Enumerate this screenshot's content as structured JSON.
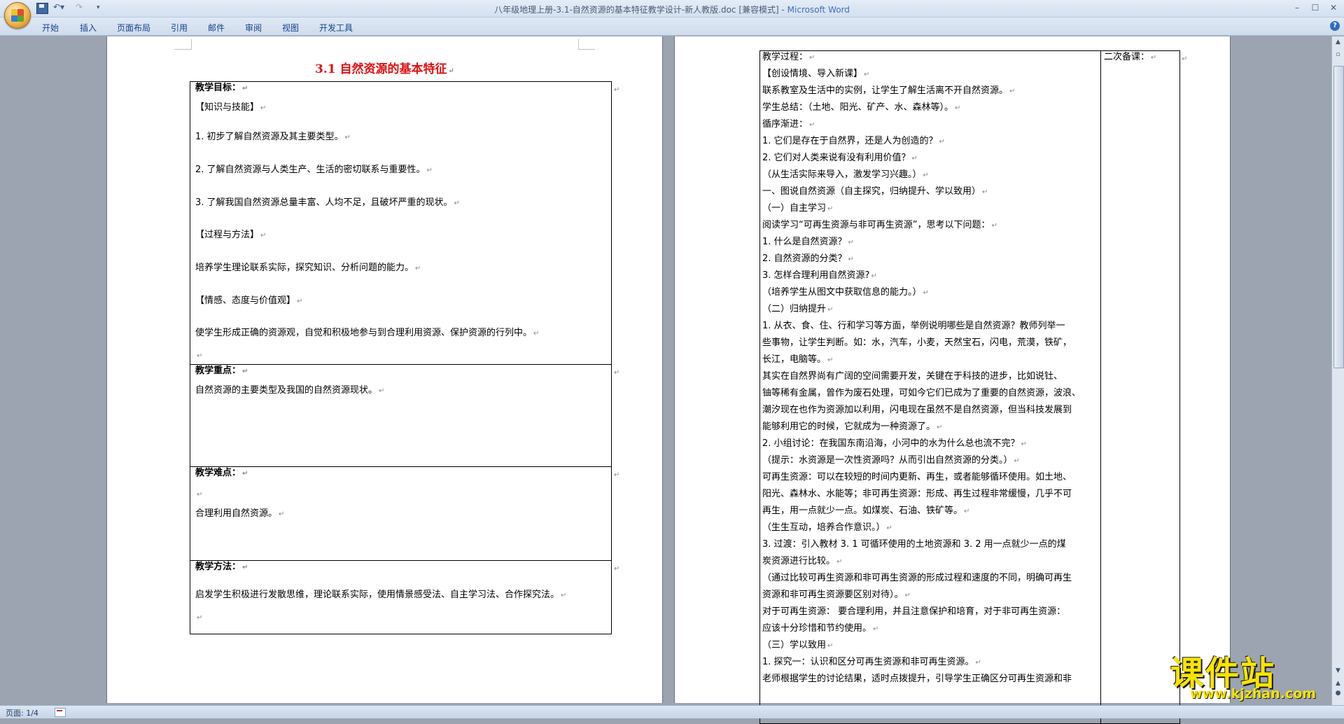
{
  "window": {
    "title": "八年级地理上册-3.1-自然资源的基本特征教学设计-新人教版.doc [兼容模式] - ",
    "app_name": "Microsoft Word"
  },
  "ribbon": {
    "tabs": [
      "开始",
      "插入",
      "页面布局",
      "引用",
      "邮件",
      "审阅",
      "视图",
      "开发工具"
    ]
  },
  "status": {
    "page": "页面: 1/4"
  },
  "watermark": {
    "main": "课件站",
    "url": "www.kjzhan.com"
  },
  "page1": {
    "title": "3.1  自然资源的基本特征",
    "goal_header": "教学目标：",
    "goal_lines": [
      "【知识与技能】",
      "1. 初步了解自然资源及其主要类型。",
      "2. 了解自然资源与人类生产、生活的密切联系与重要性。",
      "3. 了解我国自然资源总量丰富、人均不足，且破坏严重的现状。",
      "【过程与方法】",
      "培养学生理论联系实际，探究知识、分析问题的能力。",
      "【情感、态度与价值观】",
      "使学生形成正确的资源观，自觉和积极地参与到合理利用资源、保护资源的行列中。"
    ],
    "key_header": "教学重点：",
    "key_text": "自然资源的主要类型及我国的自然资源现状。",
    "diff_header": "教学难点：",
    "diff_text": "合理利用自然资源。",
    "method_header": "教学方法：",
    "method_text": "启发学生积极进行发散思维，理论联系实际，使用情景感受法、自主学习法、合作探究法。"
  },
  "page2": {
    "side_header": "二次备课：",
    "lines": [
      "教学过程：",
      "【创设情境、导入新课】",
      "    联系教室及生活中的实例，让学生了解生活离不开自然资源。",
      "学生总结：（土地、阳光、矿产、水、森林等）。",
      "循序渐进：",
      "1. 它们是存在于自然界，还是人为创造的？",
      "2. 它们对人类来说有没有利用价值？",
      "（从生活实际来导入，激发学习兴趣。）",
      "一、图说自然资源（自主探究，归纳提升、学以致用）",
      "（一）自主学习",
      "阅读学习“可再生资源与非可再生资源”，思考以下问题：",
      "1. 什么是自然资源？",
      "2. 自然资源的分类？",
      "3. 怎样合理利用自然资源?",
      "（培养学生从图文中获取信息的能力。）",
      "（二）归纳提升",
      "1. 从衣、食、住、行和学习等方面，举例说明哪些是自然资源？教师列举一",
      "些事物，让学生判断。如：水，汽车，小麦，天然宝石，闪电，荒漠，铁矿，",
      "长江，电脑等。",
      "    其实在自然界尚有广阔的空间需要开发，关键在于科技的进步，比如说钍、",
      "铀等稀有金属，曾作为废石处理，可如今它们已成为了重要的自然资源，波浪、",
      "潮汐现在也作为资源加以利用，闪电现在虽然不是自然资源，但当科技发展到",
      "能够利用它的时候，它就成为一种资源了。",
      "  2. 小组讨论：在我国东南沿海，小河中的水为什么总也流不完？",
      "（提示：水资源是一次性资源吗？从而引出自然资源的分类。）",
      "可再生资源：可以在较短的时间内更新、再生，或者能够循环使用。如土地、",
      "阳光、森林水、水能等；非可再生资源：形成、再生过程非常缓慢，几乎不可",
      "再生，用一点就少一点。如煤炭、石油、铁矿等。",
      "（生生互动，培养合作意识。）",
      "3. 过渡：引入教材 3. 1 可循环使用的土地资源和 3. 2 用一点就少一点的煤",
      "炭资源进行比较。",
      "（通过比较可再生资源和非可再生资源的形成过程和速度的不同，明确可再生",
      "资源和非可再生资源要区别对待）。",
      "对于可再生资源：  要合理利用，并且注意保护和培育，对于非可再生资源：",
      "应该十分珍惜和节约使用。",
      "（三）学以致用",
      "1. 探究一：认识和区分可再生资源和非可再生资源。",
      "老师根据学生的讨论结果，适时点拨提升，引导学生正确区分可再生资源和非"
    ]
  }
}
